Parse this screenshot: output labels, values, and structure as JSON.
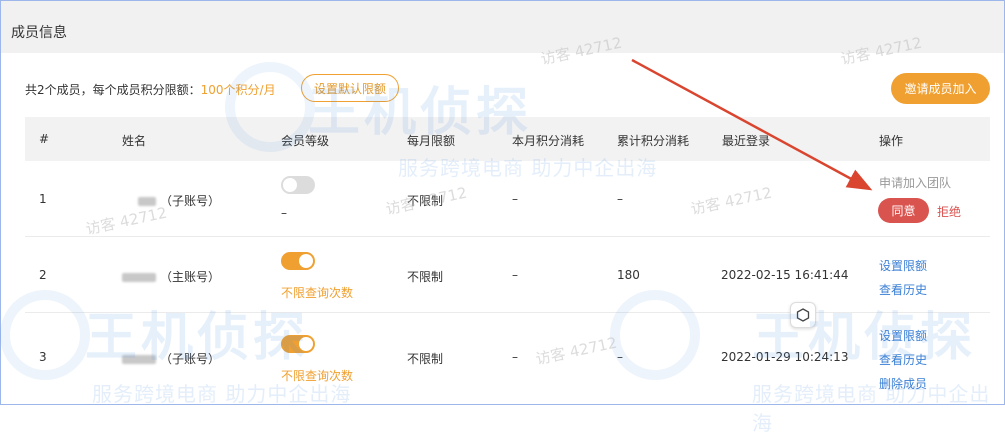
{
  "panel": {
    "title": "成员信息"
  },
  "summary": {
    "prefix": "共2个成员，每个成员积分限额：",
    "quota": "100个积分/月"
  },
  "buttons": {
    "set_default_quota": "设置默认限额",
    "invite_member": "邀请成员加入"
  },
  "table": {
    "headers": [
      "#",
      "姓名",
      "会员等级",
      "每月限额",
      "本月积分消耗",
      "累计积分消耗",
      "最近登录",
      "操作"
    ],
    "rows": [
      {
        "index": "1",
        "name_suffix": "（子账号）",
        "toggle_on": false,
        "level_note": "–",
        "monthly_limit": "不限制",
        "month_used": "–",
        "total_used": "–",
        "last_login": "",
        "status": "申请加入团队",
        "actions": [
          "同意",
          "拒绝"
        ]
      },
      {
        "index": "2",
        "name_suffix": "（主账号）",
        "toggle_on": true,
        "level_note": "不限查询次数",
        "monthly_limit": "不限制",
        "month_used": "–",
        "total_used": "180",
        "last_login": "2022-02-15 16:41:44",
        "actions": [
          "设置限额",
          "查看历史"
        ]
      },
      {
        "index": "3",
        "name_suffix": "（子账号）",
        "toggle_on": true,
        "level_note": "不限查询次数",
        "monthly_limit": "不限制",
        "month_used": "–",
        "total_used": "–",
        "last_login": "2022-01-29 10:24:13",
        "actions": [
          "设置限额",
          "查看历史",
          "删除成员"
        ]
      }
    ]
  },
  "watermark": {
    "brand": "王机侦探",
    "slogan": "服务跨境电商 助力中企出海",
    "visitor": "访客 42712"
  },
  "colors": {
    "accent": "#f0a030",
    "danger": "#d9534f",
    "link": "#3a7fd5",
    "arrow": "#d9452f"
  }
}
